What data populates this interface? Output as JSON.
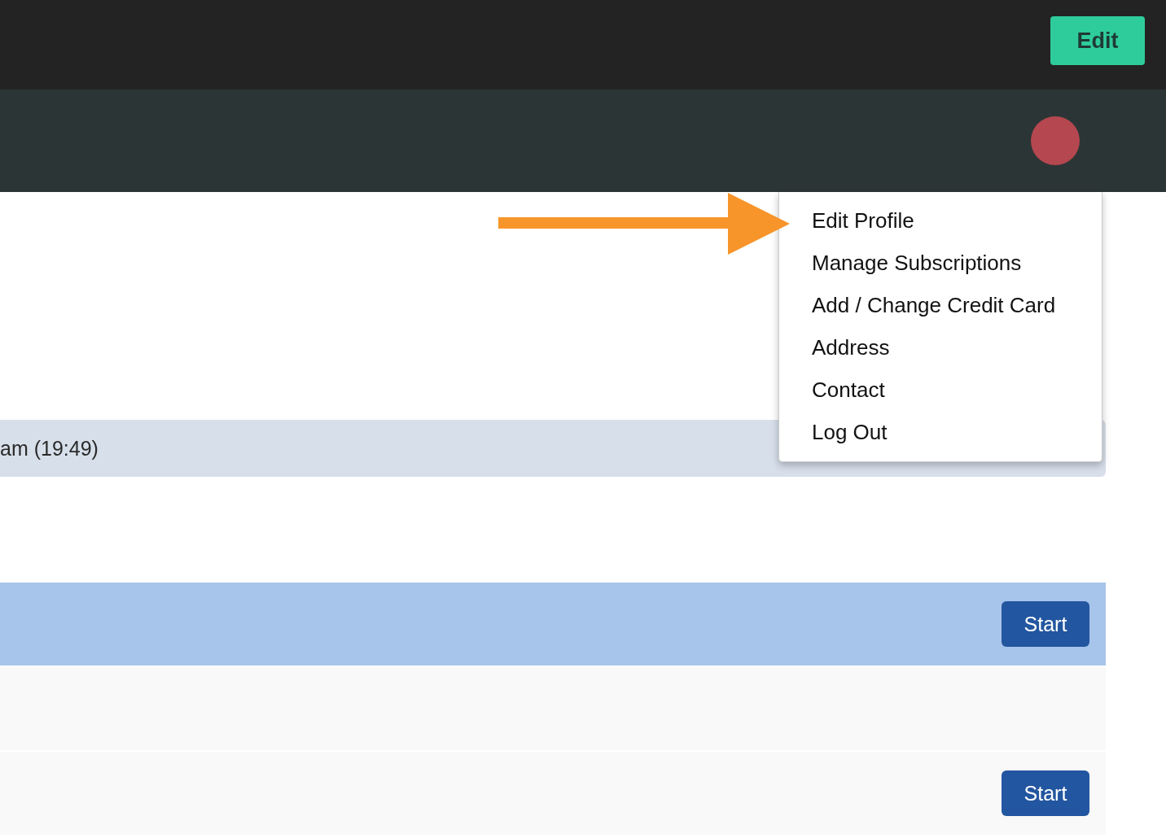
{
  "top_bar": {
    "edit_button": "Edit"
  },
  "user_menu": {
    "expanded": true,
    "items": [
      "Edit Profile",
      "Manage Subscriptions",
      "Add / Change Credit Card",
      "Address",
      "Contact",
      "Log Out"
    ]
  },
  "notice": {
    "text": "am (19:49)"
  },
  "rows": [
    {
      "selected": true,
      "button": "Start"
    },
    {
      "selected": false
    },
    {
      "selected": false,
      "button": "Start"
    }
  ]
}
